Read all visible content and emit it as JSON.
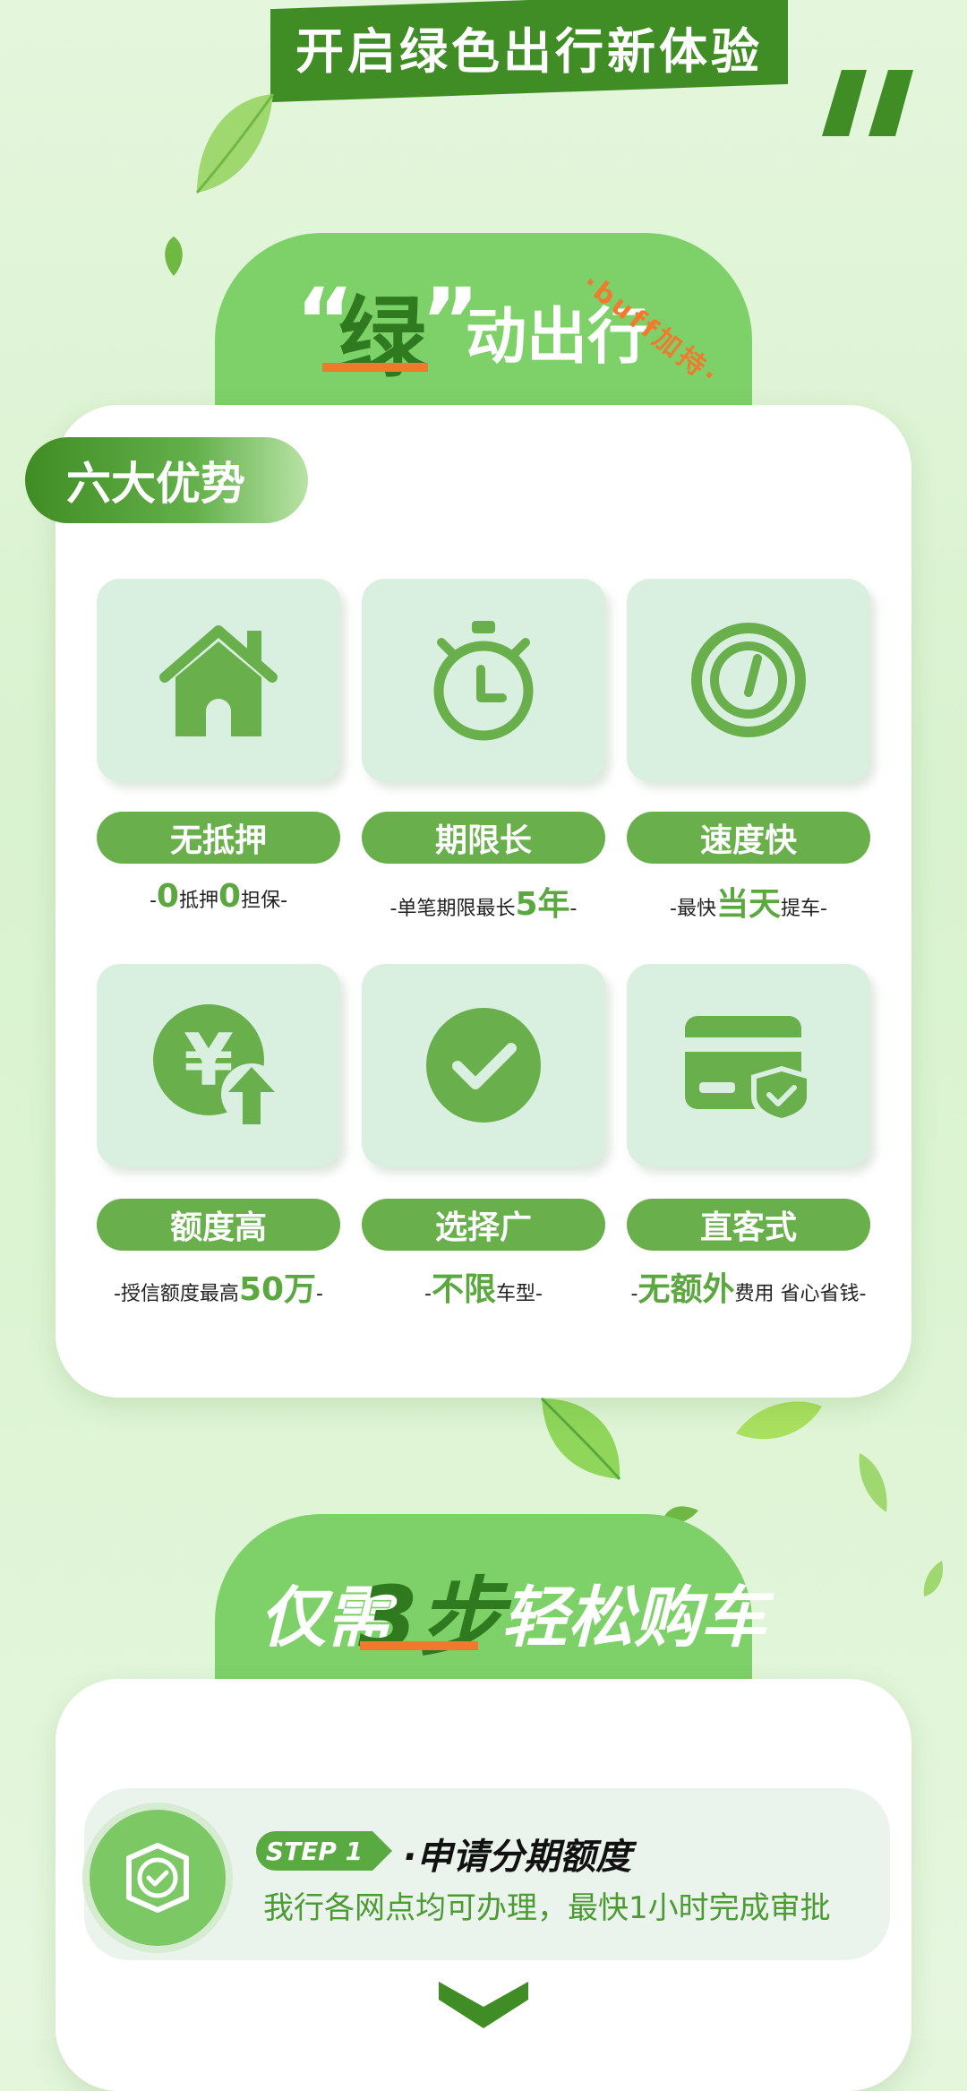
{
  "banner": {
    "title": "开启绿色出行新体验"
  },
  "section1": {
    "header": {
      "quote_open": "“",
      "green_char": "绿",
      "quote_close": "”",
      "text": "动出行",
      "buff": "·buff加持·"
    },
    "tag": "六大优势",
    "features": [
      {
        "icon": "house-icon",
        "title": "无抵押",
        "desc_parts": [
          "-",
          "0",
          "抵押",
          "0",
          "担保-"
        ]
      },
      {
        "icon": "stopwatch-icon",
        "title": "期限长",
        "desc_parts": [
          "-单笔期限最长",
          "5年",
          "-"
        ]
      },
      {
        "icon": "speedometer-icon",
        "title": "速度快",
        "desc_parts": [
          "-最快",
          "当天",
          "提车-"
        ]
      },
      {
        "icon": "yen-up-icon",
        "title": "额度高",
        "desc_parts": [
          "-授信额度最高",
          "50万",
          "-"
        ]
      },
      {
        "icon": "check-circle-icon",
        "title": "选择广",
        "desc_parts": [
          "-",
          "不限",
          "车型-"
        ]
      },
      {
        "icon": "card-shield-icon",
        "title": "直客式",
        "desc_parts": [
          "-",
          "无额外",
          "费用 省心省钱-"
        ]
      }
    ]
  },
  "section2": {
    "header": {
      "text1": "仅需",
      "num": "3步",
      "text2": "轻松购车"
    },
    "step": {
      "badge": "STEP 1",
      "title": "·申请分期额度",
      "desc": "我行各网点均可办理，最快1小时完成审批"
    }
  },
  "colors": {
    "primary": "#69b04d",
    "dark": "#3f8d24",
    "accent": "#f0792c"
  }
}
